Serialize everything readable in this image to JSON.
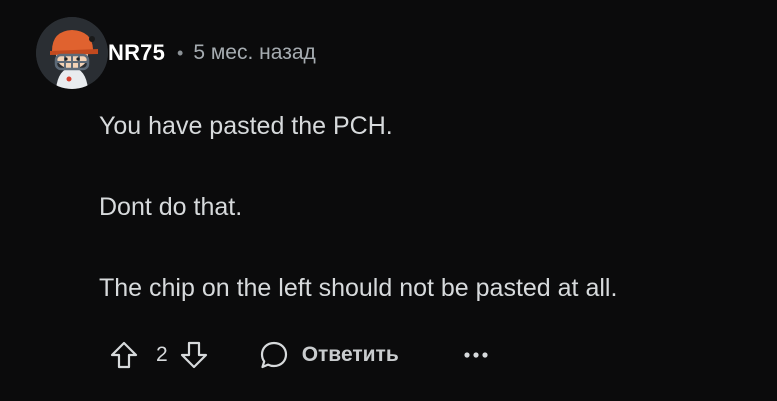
{
  "comment": {
    "author": "NR75",
    "separator": "•",
    "timestamp": "5 мес. назад",
    "paragraphs": [
      "You have pasted the PCH.",
      "Dont do that.",
      "The chip on the left should not be pasted at all."
    ],
    "score": "2",
    "reply_label": "Ответить",
    "icons": {
      "upvote": "arrow-up-outline-icon",
      "downvote": "arrow-down-outline-icon",
      "reply": "speech-bubble-icon",
      "more": "ellipsis-icon"
    }
  },
  "colors": {
    "background": "#0b0b0c",
    "text": "#d7dadc",
    "username": "#ffffff",
    "muted": "#a6acb1"
  }
}
